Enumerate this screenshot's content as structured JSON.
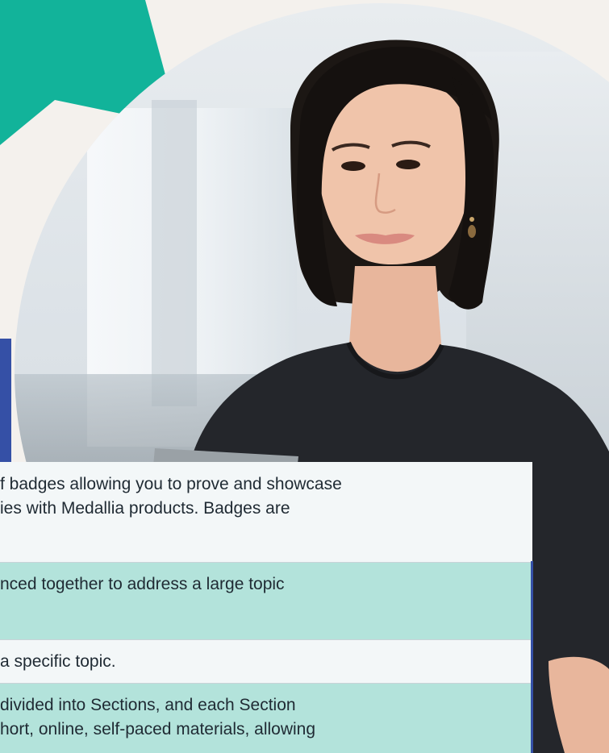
{
  "content": {
    "rows": [
      {
        "lines": [
          "f badges allowing you to prove and showcase",
          "ies with Medallia products. Badges are"
        ]
      },
      {
        "lines": [
          "nced together to address a large topic"
        ]
      },
      {
        "lines": [
          "a specific topic."
        ]
      },
      {
        "lines": [
          "divided into Sections, and each Section",
          "hort, online, self-paced materials, allowing"
        ]
      }
    ]
  },
  "colors": {
    "accent_teal": "#12b39a",
    "accent_blue": "#3550a6",
    "row_teal": "#b3e3db",
    "row_light": "#f3f7f8"
  }
}
